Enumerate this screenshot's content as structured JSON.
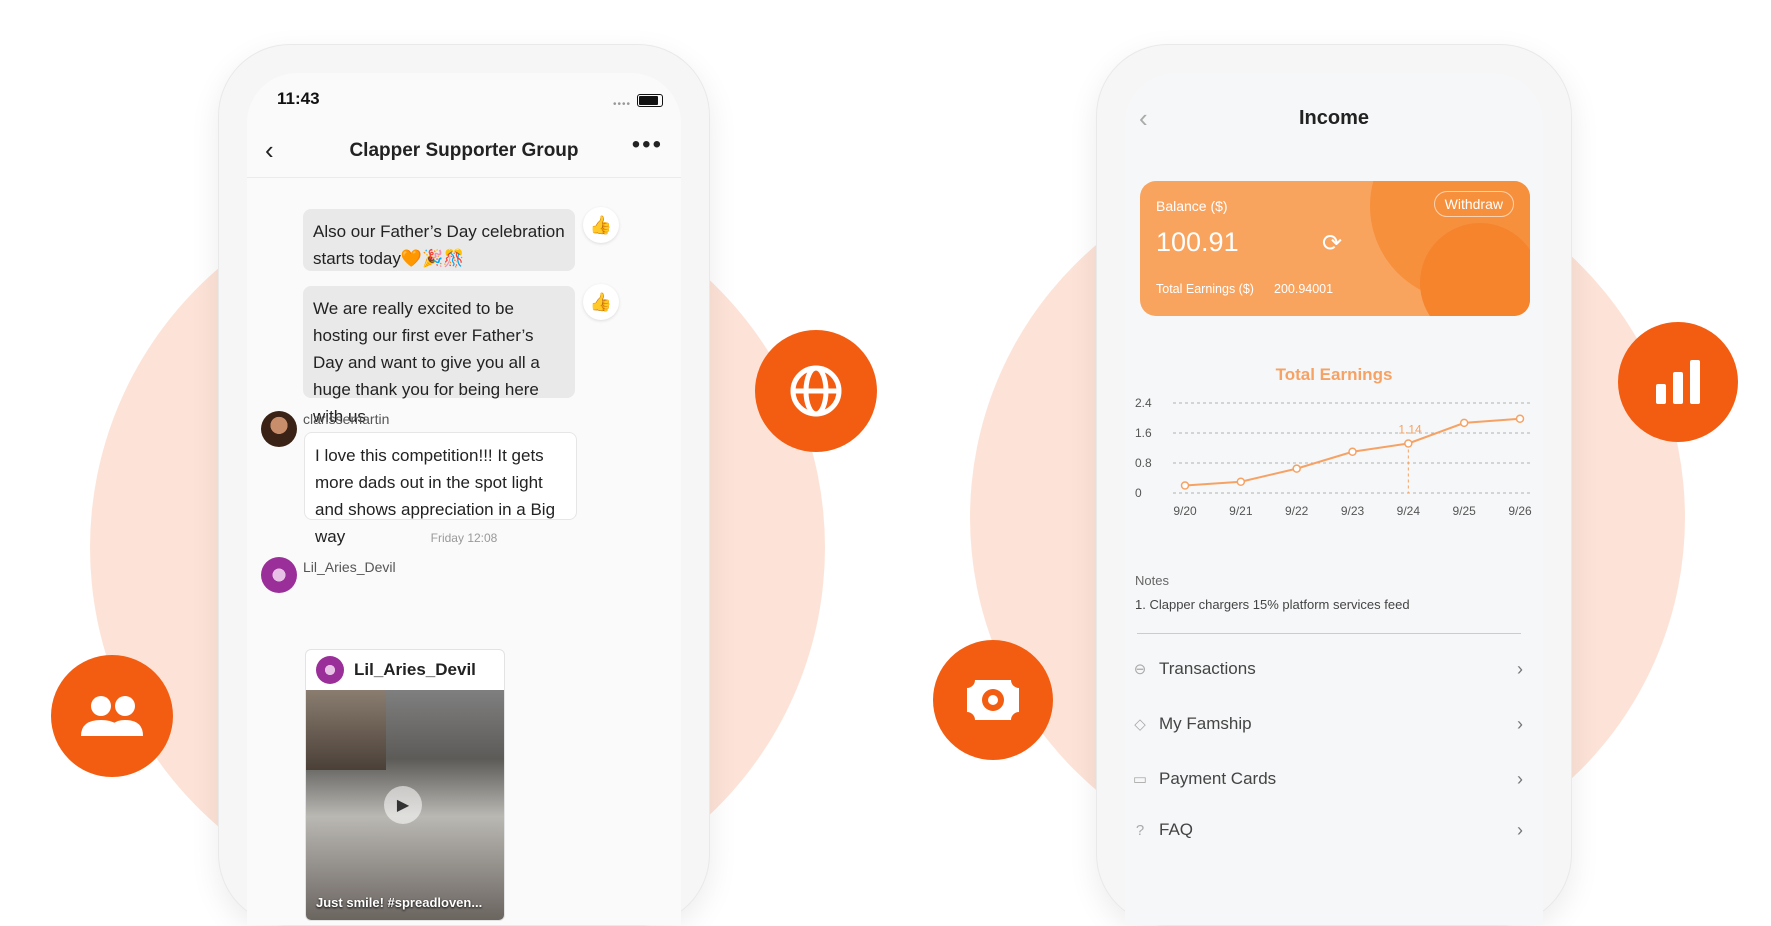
{
  "chat_screen": {
    "status_time": "11:43",
    "title": "Clapper Supporter Group",
    "messages": [
      {
        "text": "Also our Father’s Day celebration starts today🧡🎉🎊"
      },
      {
        "text": "We are really excited to be hosting our first ever Father’s Day and want to give you all a huge thank you for being here with us"
      },
      {
        "user": "clarissemartin",
        "text": "I love this competition!!! It gets more dads out in the spot light and shows appreciation in a Big way"
      }
    ],
    "timestamp": "Friday 12:08",
    "shared_post": {
      "user": "Lil_Aries_Devil",
      "card_user": "Lil_Aries_Devil",
      "caption": "Just smile!  #spreadloven..."
    }
  },
  "income_screen": {
    "title": "Income",
    "balance_label": "Balance ($)",
    "balance_value": "100.91",
    "withdraw_label": "Withdraw",
    "total_label": "Total Earnings ($)",
    "total_value": "200.94001",
    "chart_title": "Total Earnings",
    "notes_title": "Notes",
    "notes": [
      "1. Clapper chargers 15% platform services feed"
    ],
    "menu": [
      {
        "label": "Transactions",
        "icon": "transactions-icon"
      },
      {
        "label": "My Famship",
        "icon": "diamond-icon"
      },
      {
        "label": "Payment Cards",
        "icon": "card-icon"
      },
      {
        "label": "FAQ",
        "icon": "help-icon"
      }
    ]
  },
  "chart_data": {
    "type": "line",
    "title": "Total Earnings",
    "categories": [
      "9/20",
      "9/21",
      "9/22",
      "9/23",
      "9/24",
      "9/25",
      "9/26"
    ],
    "y_ticks": [
      "2.4",
      "1.6",
      "0.8",
      "0"
    ],
    "ylim": [
      0,
      2.4
    ],
    "series": [
      {
        "values": [
          0.2,
          0.3,
          0.65,
          1.1,
          1.32,
          1.87,
          1.98
        ]
      }
    ],
    "highlight": {
      "index": 4,
      "label": "1.14"
    },
    "grid": true,
    "color": "#f6a264"
  },
  "colors": {
    "accent": "#f35d12",
    "card": "#f8a45f",
    "blob": "#fde3d7"
  },
  "badges": [
    "group-icon",
    "globe-icon",
    "money-icon",
    "bar-chart-icon"
  ]
}
